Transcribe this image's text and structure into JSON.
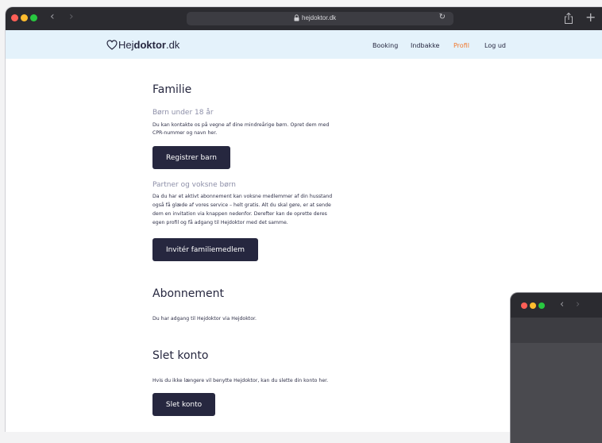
{
  "browser": {
    "url": "hejdoktor.dk",
    "back_icon": "chevron-left-icon",
    "forward_icon": "chevron-right-icon",
    "reload_icon": "reload-icon",
    "share_icon": "share-icon",
    "new_tab_icon": "plus-icon"
  },
  "site": {
    "logo_prefix": "Hej",
    "logo_bold": "doktor",
    "logo_suffix": ".dk",
    "nav": {
      "booking": "Booking",
      "inbox": "Indbakke",
      "profile": "Profil",
      "logout": "Log ud"
    },
    "colors": {
      "header_bg": "#e4f2fb",
      "primary": "#26273f",
      "accent": "#f2772b"
    }
  },
  "family": {
    "title": "Familie",
    "children_heading": "Børn under 18 år",
    "children_text_1": "Du kan kontakte os på vegne af dine mindreårige børn. Opret dem med",
    "children_text_2": "CPR-nummer og navn her.",
    "register_button": "Registrer barn",
    "partner_heading": "Partner og voksne børn",
    "partner_text_1": "Da du har et aktivt abonnement kan voksne medlemmer af din husstand",
    "partner_text_2": "også få glæde af vores service – helt gratis. Alt du skal gøre, er at sende",
    "partner_text_3": "dem en invitation via knappen nedenfor. Derefter kan de oprette deres",
    "partner_text_4": "egen profil og få adgang til Hejdoktor med det samme.",
    "invite_button": "Invitér familiemedlem"
  },
  "subscription": {
    "title": "Abonnement",
    "text": "Du har adgang til Hejdoktor via Hejdoktor."
  },
  "delete": {
    "title": "Slet konto",
    "text": "Hvis du ikke længere vil benytte Hejdoktor, kan du slette din konto her.",
    "button": "Slet konto"
  }
}
